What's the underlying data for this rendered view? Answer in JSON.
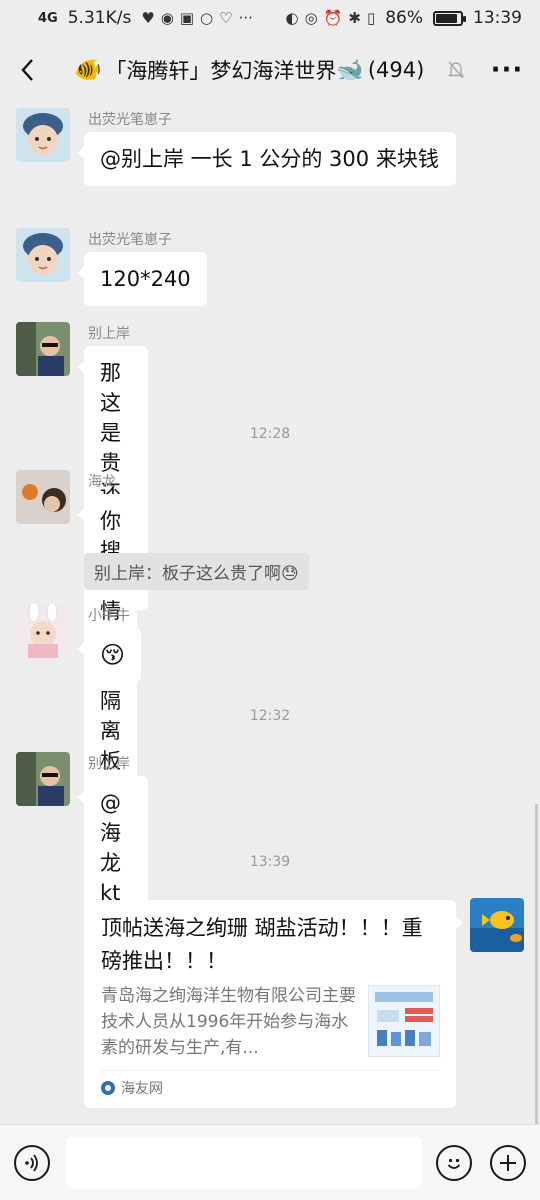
{
  "status_bar": {
    "signal": "4G",
    "speed": "5.31K/s",
    "battery": "86%",
    "battery_level": 0.86,
    "time": "13:39"
  },
  "nav": {
    "back_icon": "back-arrow-icon",
    "title": "「海腾轩」梦幻海洋世界",
    "count": "(494)",
    "title_emoji_left": "🐠",
    "title_emoji_right": "🐋",
    "mute_icon": "bell-off-icon",
    "more_icon": "more-dots-icon"
  },
  "messages": [
    {
      "sender": "出荧光笔崽子",
      "text": "@别上岸  一长 1 公分的 300 来块钱"
    },
    {
      "sender": "出荧光笔崽子",
      "text": "120*240"
    },
    {
      "sender": "别上岸",
      "text": "那这是贵还是便宜?"
    },
    {
      "time": "12:28"
    },
    {
      "sender": "海龙",
      "text": "你搜疫情餐桌隔离板",
      "quote": "别上岸：板子这么贵了啊😓"
    },
    {
      "sender": "小牛牛",
      "text": "😚"
    },
    {
      "time": "12:32"
    },
    {
      "sender": "别上岸",
      "text": "@海龙  kt 板啊?"
    },
    {
      "time": "13:39"
    }
  ],
  "card": {
    "title": "顶帖送海之绚珊 瑚盐活动！！！重磅推出！！！",
    "description": "青岛海之绚海洋生物有限公司主要技术人员从1996年开始参与海水素的研发与生产,有...",
    "source": "海友网"
  },
  "input_bar": {
    "placeholder": "",
    "voice_icon": "voice-icon",
    "emoji_icon": "emoji-icon",
    "plus_icon": "plus-icon"
  },
  "colors": {
    "background": "#ededed",
    "bubble": "#ffffff",
    "secondary_text": "#888888"
  }
}
